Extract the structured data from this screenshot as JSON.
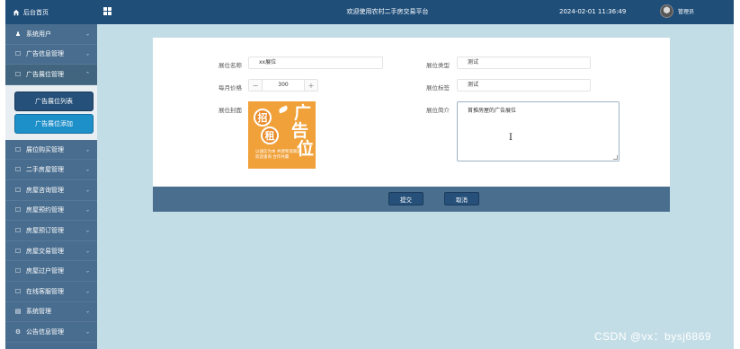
{
  "header": {
    "home_label": "后台首页",
    "site_title": "欢迎使用农村二手房交易平台",
    "datetime": "2024-02-01 11:36:49",
    "username": "管理员"
  },
  "sidebar": {
    "items": [
      {
        "icon": "user-icon",
        "glyph": "♟",
        "label": "系统用户"
      },
      {
        "icon": "doc-icon",
        "glyph": "☐",
        "label": "广告信息管理"
      },
      {
        "icon": "doc-icon",
        "glyph": "☐",
        "label": "广告展位管理",
        "open": true
      }
    ],
    "submenu": {
      "list_label": "广告展位列表",
      "add_label": "广告展位添加"
    },
    "items_after": [
      {
        "glyph": "☐",
        "label": "展位购买管理"
      },
      {
        "glyph": "☐",
        "label": "二手房屋管理"
      },
      {
        "glyph": "☐",
        "label": "房屋咨询管理"
      },
      {
        "glyph": "☐",
        "label": "房屋预约管理"
      },
      {
        "glyph": "☐",
        "label": "房屋预订管理"
      },
      {
        "glyph": "☐",
        "label": "房屋交易管理"
      },
      {
        "glyph": "☐",
        "label": "房屋过户管理"
      },
      {
        "glyph": "☐",
        "label": "在线客服管理"
      },
      {
        "glyph": "▤",
        "label": "系统管理"
      },
      {
        "glyph": "⚙",
        "label": "公告信息管理"
      }
    ]
  },
  "form": {
    "name_label": "展位名称",
    "name_value": "xx展位",
    "type_label": "展位类型",
    "type_value": "测试",
    "price_label": "每月价格",
    "price_value": "300",
    "tag_label": "展位标签",
    "tag_value": "测试",
    "cover_label": "展位封面",
    "intro_label": "展位简介",
    "intro_value": "首推房屋的广告展位"
  },
  "poster": {
    "char1": "招",
    "char2": "租",
    "big1": "广",
    "big2": "告",
    "big3": "位",
    "line1": "以诚信为本 共建和谐家园",
    "line2": "欢迎垂询 合作共赢"
  },
  "buttons": {
    "submit": "提交",
    "cancel": "取消"
  },
  "watermark": "CSDN @vx：bysj6869",
  "colors": {
    "header": "#1f4e79",
    "sidebar": "#496d8f",
    "content_bg": "#c3dde6",
    "accent": "#1d8fc9"
  }
}
